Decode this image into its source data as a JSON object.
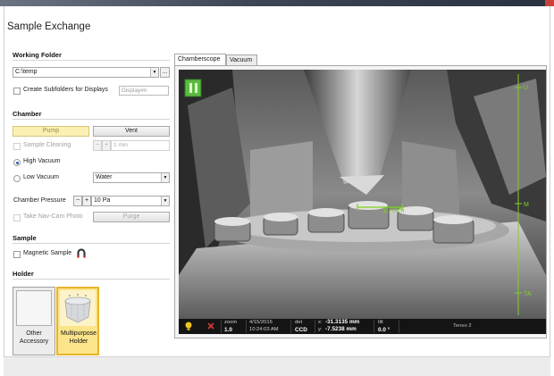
{
  "window": {
    "title": "Sample Exchange"
  },
  "working_folder": {
    "heading": "Working Folder",
    "path": "C:\\temp",
    "browse_label": "...",
    "create_subfolders_label": "Create Subfolders for Displays",
    "create_subfolders_checked": false,
    "display_pattern_placeholder": "Display#n"
  },
  "chamber": {
    "heading": "Chamber",
    "pump_label": "Pump",
    "vent_label": "Vent",
    "sample_cleaning_label": "Sample Cleaning",
    "cleaning_minus": "−",
    "cleaning_plus": "+",
    "cleaning_duration": "1 min",
    "high_vacuum_label": "High Vacuum",
    "high_vacuum_selected": true,
    "low_vacuum_label": "Low Vacuum",
    "low_vacuum_gas": "Water",
    "pressure_label": "Chamber Pressure",
    "pressure_minus": "−",
    "pressure_plus": "+",
    "pressure_value": "10 Pa",
    "navcam_label": "Take Nav-Cam Photo",
    "purge_label": "Purge"
  },
  "sample": {
    "heading": "Sample",
    "magnetic_label": "Magnetic Sample"
  },
  "holder": {
    "heading": "Holder",
    "items": [
      {
        "label_line1": "Other",
        "label_line2": "Accessory",
        "selected": false
      },
      {
        "label_line1": "Multipurpose",
        "label_line2": "Holder",
        "selected": true
      }
    ]
  },
  "tabs": [
    {
      "label": "Chamberscope",
      "active": true
    },
    {
      "label": "Vacuum",
      "active": false
    }
  ],
  "scope": {
    "scale_label": "10 mm",
    "axis_marks": {
      "top": "U",
      "middle": "M",
      "bottom": "TA"
    },
    "status": {
      "zoom_label": "zoom",
      "zoom_value": "1.0",
      "date": "4/15/2016",
      "time": "10:24:03 AM",
      "det_label": "det",
      "det_value": "CCD",
      "x_coord": "-31.3135 mm",
      "y_coord": "-7.5238 mm",
      "tilt_label": "tilt",
      "tilt_value": "0.0 °",
      "instrument": "Teneo 2"
    }
  },
  "colors": {
    "accent": "#e6b42a",
    "pump_bg": "#fbefb3",
    "scale_green": "#7ed321",
    "pause_green": "#5dbb3f"
  }
}
